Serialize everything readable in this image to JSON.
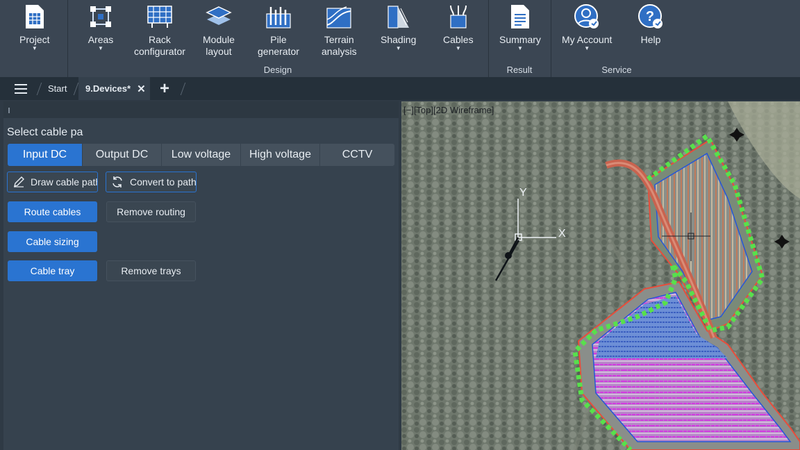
{
  "ribbon": {
    "project": "Project",
    "areas": "Areas",
    "rack_configurator": [
      "Rack",
      "configurator"
    ],
    "module_layout": [
      "Module",
      "layout"
    ],
    "pile_generator": [
      "Pile",
      "generator"
    ],
    "terrain_analysis": [
      "Terrain",
      "analysis"
    ],
    "shading": "Shading",
    "cables": "Cables",
    "summary": "Summary",
    "my_account": "My Account",
    "help": "Help",
    "groups": {
      "design": "Design",
      "result": "Result",
      "service": "Service"
    }
  },
  "tabs": {
    "start": "Start",
    "active": "9.Devices*"
  },
  "panel": {
    "title": "Select cable pa",
    "segments": [
      "Input DC",
      "Output DC",
      "Low voltage",
      "High voltage",
      "CCTV"
    ],
    "draw_cable_path": "Draw cable path",
    "convert_to_path": "Convert to path",
    "route_cables": "Route cables",
    "remove_routing": "Remove routing",
    "cable_sizing": "Cable sizing",
    "cable_tray": "Cable tray",
    "remove_trays": "Remove trays"
  },
  "viewport": {
    "label": "[−][Top][2D Wireframe]",
    "axis_x": "X",
    "axis_y": "Y"
  },
  "colors": {
    "accent": "#2a74d1",
    "ribbon": "#3b4653",
    "panel": "#36424e"
  }
}
